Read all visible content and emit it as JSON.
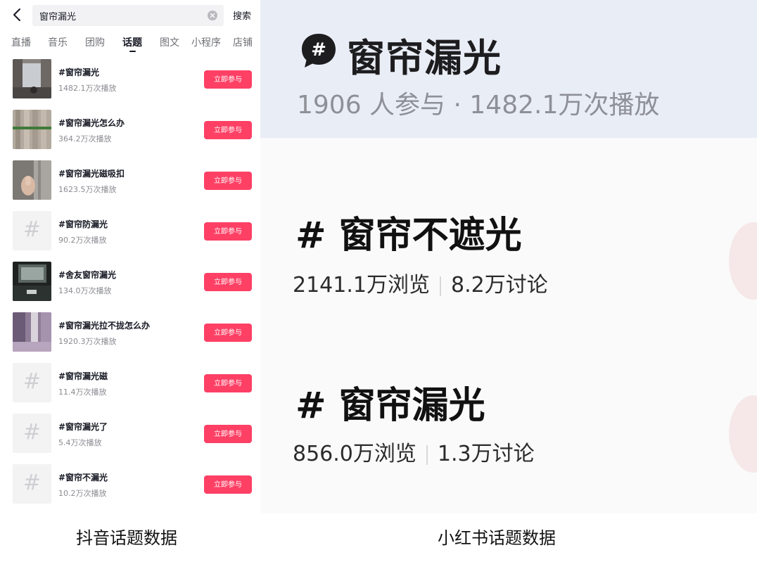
{
  "douyin": {
    "search": {
      "query": "窗帘漏光",
      "button": "搜索"
    },
    "tabs": [
      "直播",
      "音乐",
      "团购",
      "话题",
      "图文",
      "小程序",
      "店铺"
    ],
    "active_tab": "话题",
    "join_label": "立即参与",
    "topics": [
      {
        "title": "#窗帘漏光",
        "plays": "1482.1万次播放",
        "thumb": "photo-dark-room"
      },
      {
        "title": "#窗帘漏光怎么办",
        "plays": "364.2万次播放",
        "thumb": "photo-beige-curtain"
      },
      {
        "title": "#窗帘漏光磁吸扣",
        "plays": "1623.5万次播放",
        "thumb": "photo-hand-curtain"
      },
      {
        "title": "#窗帘防漏光",
        "plays": "90.2万次播放",
        "thumb": "hash-placeholder"
      },
      {
        "title": "#舍友窗帘漏光",
        "plays": "134.0万次播放",
        "thumb": "photo-night-room"
      },
      {
        "title": "#窗帘漏光拉不拢怎么办",
        "plays": "1920.3万次播放",
        "thumb": "photo-purple-curtain"
      },
      {
        "title": "#窗帘漏光磁",
        "plays": "11.4万次播放",
        "thumb": "hash-placeholder"
      },
      {
        "title": "#窗帘漏光了",
        "plays": "5.4万次播放",
        "thumb": "hash-placeholder"
      },
      {
        "title": "#窗帘不漏光",
        "plays": "10.2万次播放",
        "thumb": "hash-placeholder"
      }
    ]
  },
  "xiaohongshu": {
    "hero": {
      "title": "窗帘漏光",
      "stats": "1906 人参与 · 1482.1万次播放",
      "icon": "hash-bubble-icon"
    },
    "cards": [
      {
        "title": "# 窗帘不遮光",
        "views": "2141.1万浏览",
        "discussions": "8.2万讨论"
      },
      {
        "title": "# 窗帘漏光",
        "views": "856.0万浏览",
        "discussions": "1.3万讨论"
      }
    ]
  },
  "captions": {
    "left": "抖音话题数据",
    "right": "小红书话题数据"
  },
  "colors": {
    "join_button": "#fe2c55",
    "hero_background": "#e9edf6"
  }
}
